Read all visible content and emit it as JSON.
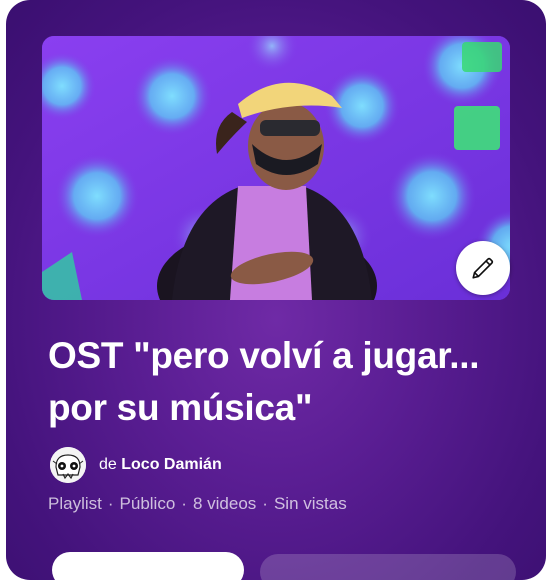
{
  "playlist": {
    "title_line1": "OST \"pero volví a jugar...",
    "title_line2": "por su música\"",
    "owner_prefix": "de",
    "owner_name": "Loco Damián",
    "meta": [
      "Playlist",
      "Público",
      "8 videos",
      "Sin vistas"
    ],
    "meta_separator": "·"
  },
  "icons": {
    "edit": "pencil-icon",
    "avatar": "skull-avatar-icon"
  },
  "colors": {
    "card_background": "#5b1e94",
    "thumbnail_background": "#7d3fe6",
    "title_text": "#ffffff",
    "meta_text": "#c8b4dc"
  }
}
